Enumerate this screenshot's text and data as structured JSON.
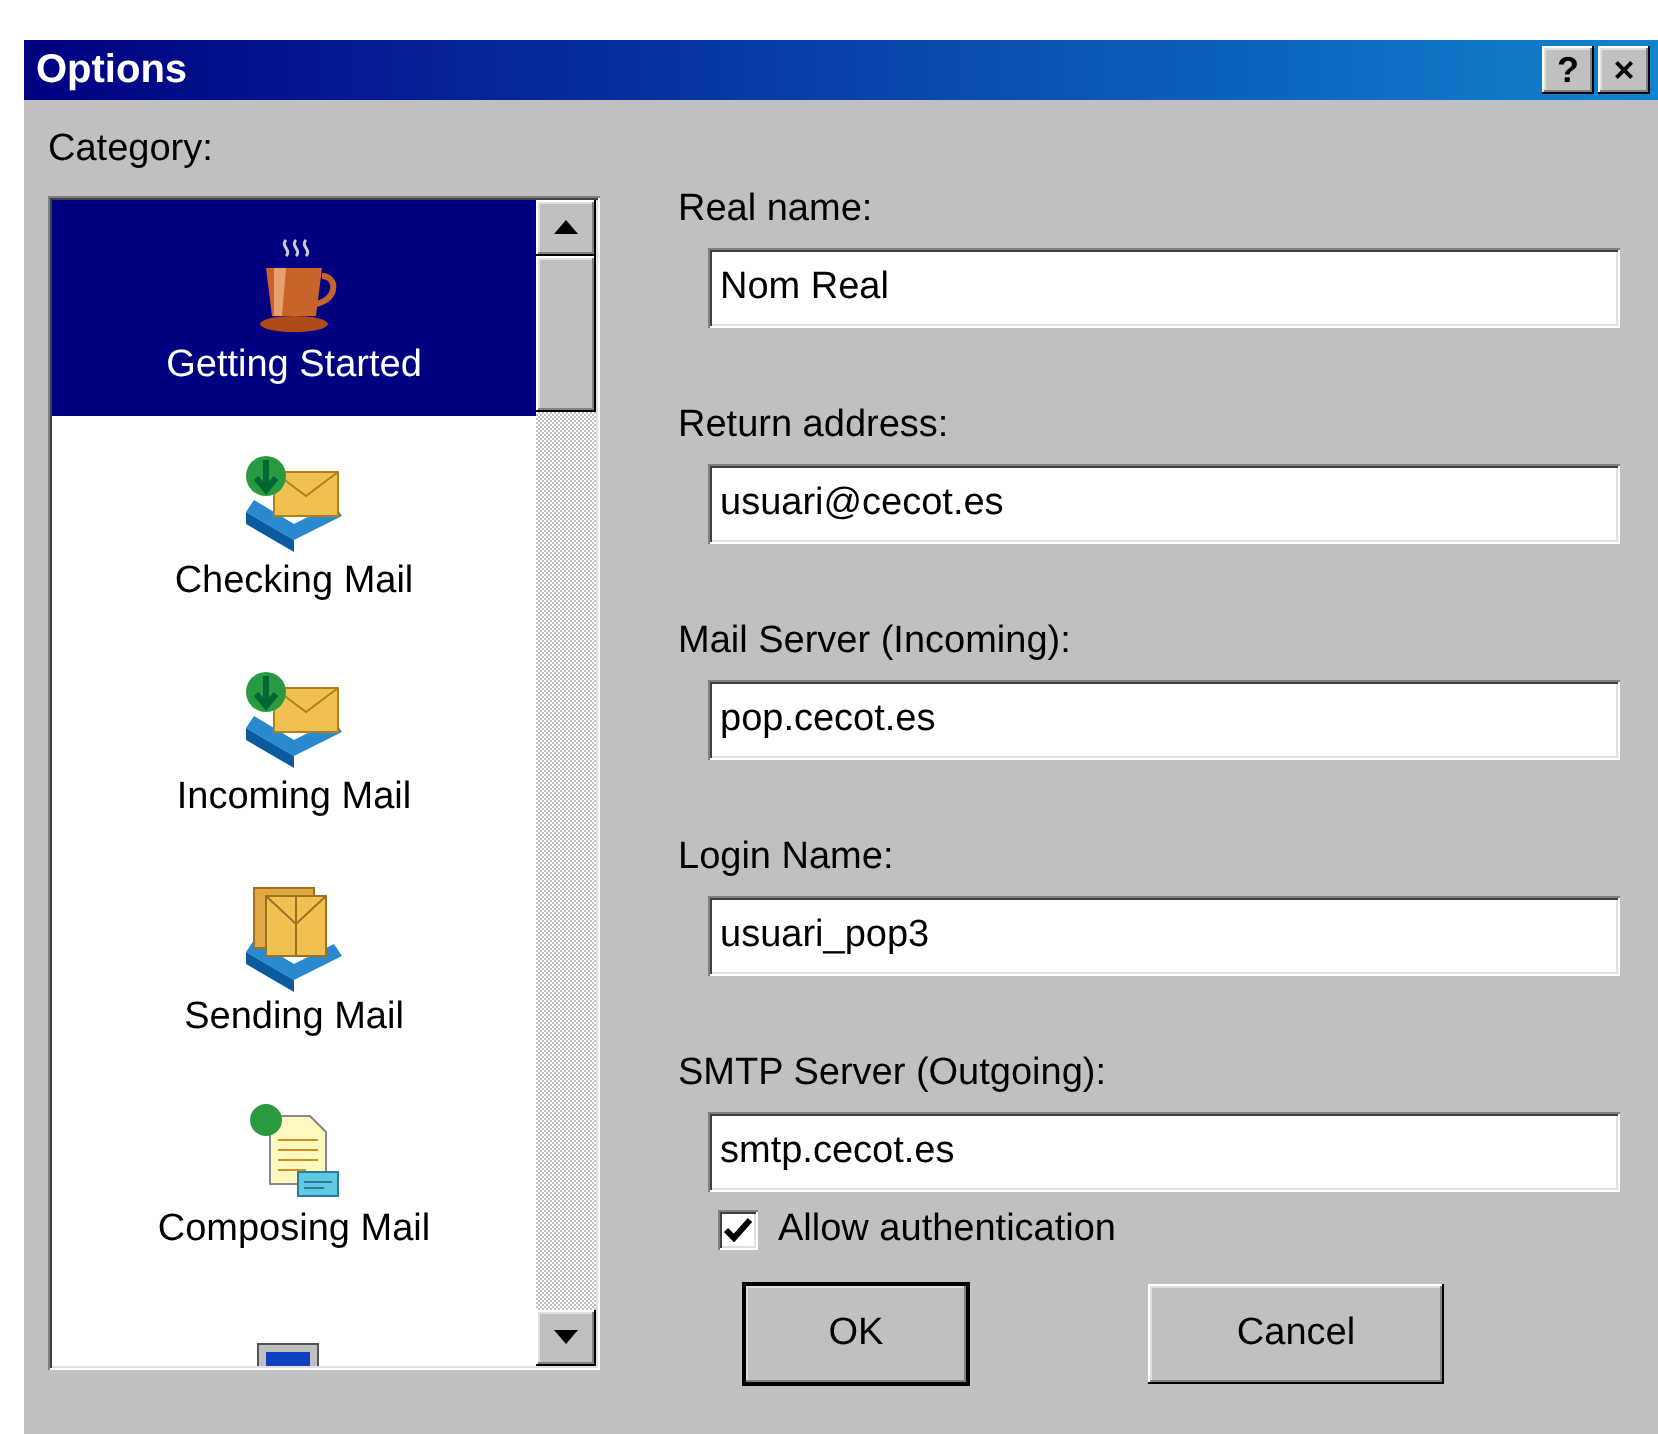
{
  "window": {
    "title": "Options",
    "help_button": "?",
    "close_button": "×"
  },
  "category_label": "Category:",
  "categories": [
    {
      "kind": "coffee",
      "label": "Getting Started",
      "selected": true
    },
    {
      "kind": "inbox",
      "label": "Checking Mail",
      "selected": false
    },
    {
      "kind": "inbox",
      "label": "Incoming Mail",
      "selected": false
    },
    {
      "kind": "outbox",
      "label": "Sending Mail",
      "selected": false
    },
    {
      "kind": "compose",
      "label": "Composing Mail",
      "selected": false
    },
    {
      "kind": "computer",
      "selected": false
    }
  ],
  "fields": [
    {
      "label": "Real name:",
      "value": "Nom Real"
    },
    {
      "label": "Return address:",
      "value": "usuari@cecot.es"
    },
    {
      "label": "Mail Server (Incoming):",
      "value": "pop.cecot.es"
    },
    {
      "label": "Login Name:",
      "value": "usuari_pop3"
    },
    {
      "label": "SMTP Server (Outgoing):",
      "value": "smtp.cecot.es"
    }
  ],
  "authentication": {
    "label": "Allow authentication",
    "checked": true
  },
  "buttons": [
    {
      "label": "OK",
      "default": true
    },
    {
      "label": "Cancel",
      "default": false
    }
  ]
}
